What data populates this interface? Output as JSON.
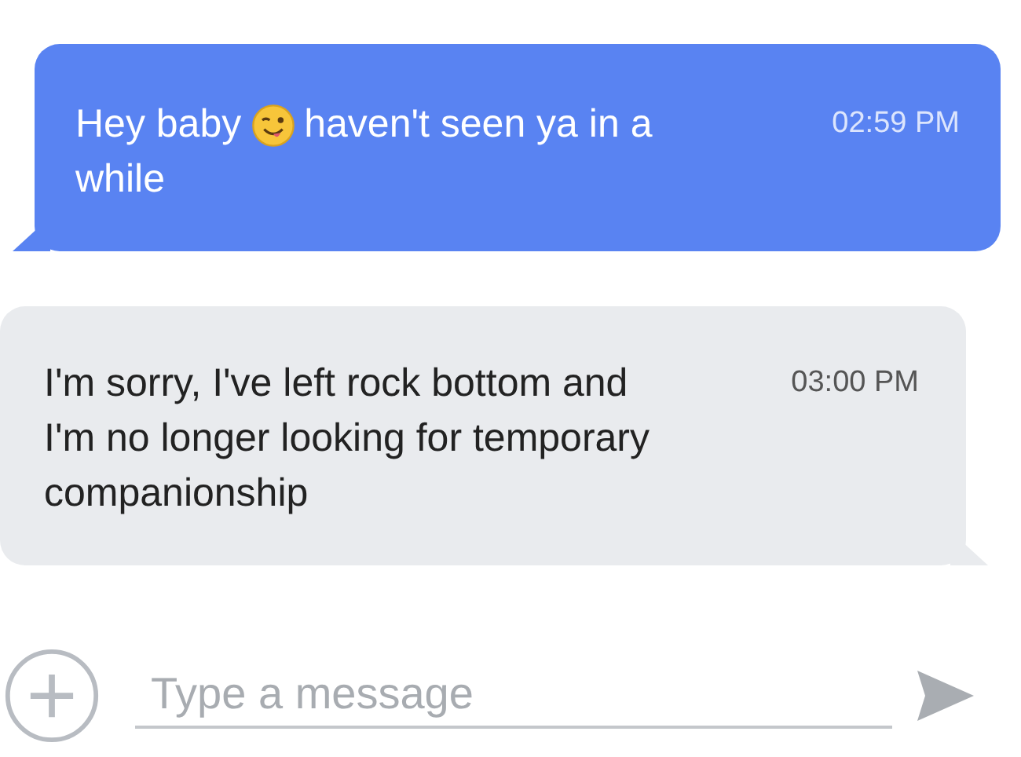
{
  "messages": [
    {
      "kind": "sent",
      "lines": [
        [
          {
            "kind": "text",
            "text": "Hey baby"
          },
          {
            "kind": "emoji"
          },
          {
            "kind": "text",
            "text": "haven't seen ya in a"
          }
        ],
        [
          {
            "kind": "text",
            "text": "while"
          }
        ]
      ],
      "time": "02:59 PM"
    },
    {
      "kind": "received",
      "lines": [
        [
          {
            "kind": "text",
            "text": "I'm sorry, I've left rock bottom and I'm no longer looking for temporary companionship"
          }
        ]
      ],
      "time": "03:00 PM"
    }
  ],
  "composer": {
    "placeholder": "Type a message"
  }
}
